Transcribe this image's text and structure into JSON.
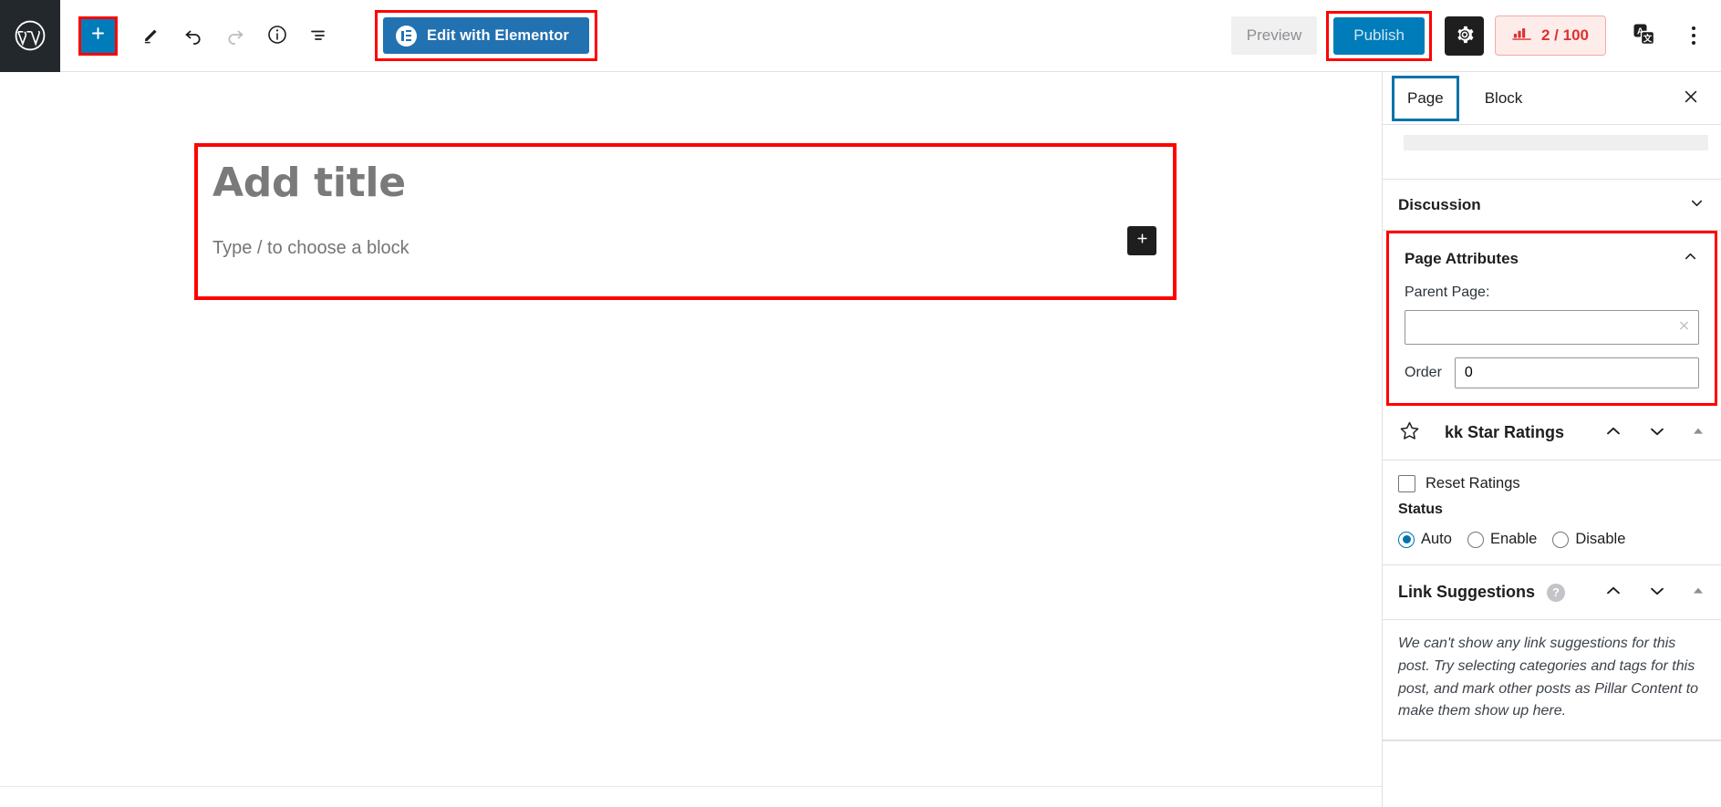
{
  "topbar": {
    "logo_icon": "wordpress-logo-icon",
    "add_block_icon": "plus-icon",
    "tools": [
      {
        "name": "edit-pencil-icon",
        "label": "Tools"
      },
      {
        "name": "undo-icon",
        "label": "Undo"
      },
      {
        "name": "redo-icon",
        "label": "Redo"
      },
      {
        "name": "info-icon",
        "label": "Details"
      },
      {
        "name": "list-view-icon",
        "label": "List view"
      }
    ],
    "elementor": {
      "label": "Edit with Elementor",
      "icon": "elementor-logo-icon",
      "bg": "#2271b1"
    },
    "preview_label": "Preview",
    "publish_label": "Publish",
    "publish_bg": "#007cba",
    "settings_icon": "gear-icon",
    "seo_badge": {
      "icon": "rank-math-icon",
      "value": "2 / 100",
      "color": "#dc3232",
      "bg": "#fdecea"
    },
    "translate_icon": "translate-icon",
    "kebab_icon": "more-options-icon",
    "highlight_color": "#ff0000"
  },
  "editor": {
    "title_placeholder": "Add title",
    "paragraph_placeholder": "Type / to choose a block",
    "inline_add_icon": "plus-icon"
  },
  "sidebar": {
    "tabs": [
      {
        "label": "Page",
        "active": true
      },
      {
        "label": "Block",
        "active": false
      }
    ],
    "close_icon": "close-icon",
    "active_tab_outline": "#0073aa",
    "panels": [
      {
        "label": "Discussion",
        "chevron": "chevron-down-icon",
        "expanded": false
      }
    ],
    "page_attributes": {
      "title": "Page Attributes",
      "chevron": "chevron-up-icon",
      "parent_label": "Parent Page:",
      "parent_value": "",
      "parent_clear_icon": "clear-icon",
      "order_label": "Order",
      "order_value": "0"
    },
    "kk_star_ratings": {
      "icon": "star-outline-icon",
      "title": "kk Star Ratings",
      "controls": [
        "chevron-up-icon",
        "chevron-down-icon",
        "collapse-triangle-icon"
      ],
      "reset_label": "Reset Ratings",
      "reset_checked": false,
      "status_label": "Status",
      "status_options": [
        {
          "label": "Auto",
          "selected": true
        },
        {
          "label": "Enable",
          "selected": false
        },
        {
          "label": "Disable",
          "selected": false
        }
      ]
    },
    "link_suggestions": {
      "title": "Link Suggestions",
      "help_icon": "help-icon",
      "help_glyph": "?",
      "controls": [
        "chevron-up-icon",
        "chevron-down-icon",
        "collapse-triangle-icon"
      ],
      "notice": "We can't show any link suggestions for this post. Try selecting categories and tags for this post, and mark other posts as Pillar Content to make them show up here."
    }
  }
}
